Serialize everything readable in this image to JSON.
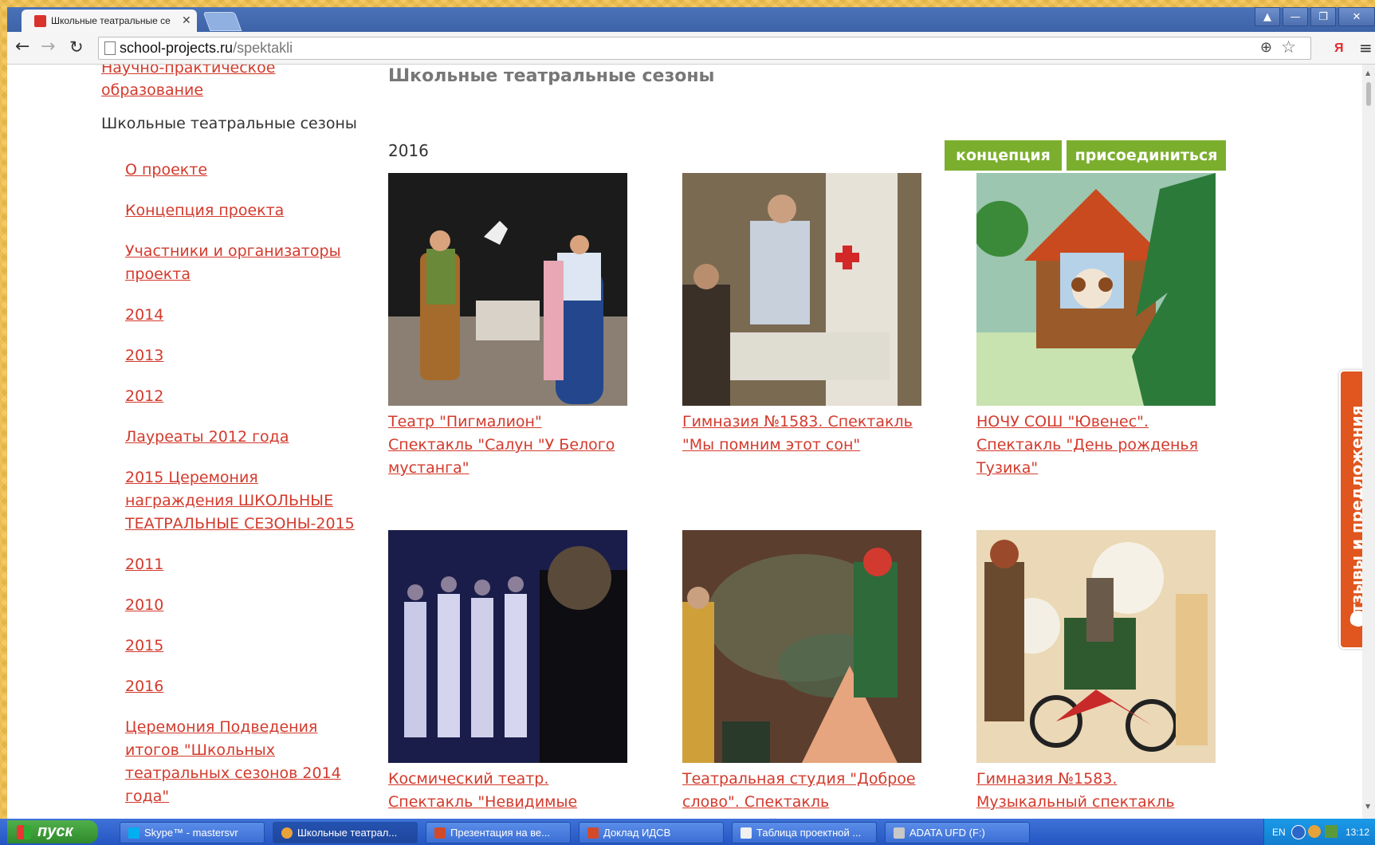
{
  "browser": {
    "tab_title": "Школьные театральные се",
    "tab_close": "✕",
    "url_domain": "school-projects.ru",
    "url_path": "/spektakli",
    "win_controls": [
      "▲",
      "—",
      "❐",
      "✕"
    ],
    "yandex_label": "Я"
  },
  "page": {
    "sidebar_cut_text": "Научно-практическое образование",
    "sidebar_heading": "Школьные театральные сезоны",
    "sidebar_items": [
      "О проекте",
      "Концепция проекта",
      "Участники и организаторы проекта",
      "2014",
      "2013",
      "2012",
      "Лауреаты 2012 года",
      "2015 Церемония награждения ШКОЛЬНЫЕ ТЕАТРАЛЬНЫЕ СЕЗОНЫ-2015",
      "2011",
      "2010",
      "2015",
      "2016",
      "Церемония Подведения итогов \"Школьных театральных сезонов 2014 года\""
    ],
    "title": "Школьные театральные сезоны",
    "year": "2016",
    "btn_concept": "концепция",
    "btn_join": "присоединиться",
    "cards": [
      "Театр \"Пигмалион\" Спектакль \"Салун \"У Белого мустанга\"",
      "Гимназия №1583. Спектакль \"Мы помним этот сон\"",
      "НОЧУ СОШ \"Ювенес\". Спектакль \"День рожденья Тузика\"",
      "Космический театр. Спектакль \"Невидимые миры\"",
      "Театральная студия \"Доброе слово\". Спектакль \"Маленький",
      "Гимназия №1583. Музыкальный спектакль"
    ],
    "feedback_label": "Отзывы и предложения"
  },
  "taskbar": {
    "start_label": "пуск",
    "tasks": [
      "Skype™ - mastersvr",
      "Школьные театрал...",
      "Презентация на ве...",
      "Доклад ИДСВ",
      "Таблица проектной ...",
      "ADATA UFD (F:)"
    ],
    "tray_lang": "EN",
    "clock": "13:12"
  },
  "colors": {
    "link": "#d33a2c",
    "button_green": "#7cae2e",
    "feedback_orange": "#e0561e",
    "titlebar_blue": "#3d63a8"
  }
}
